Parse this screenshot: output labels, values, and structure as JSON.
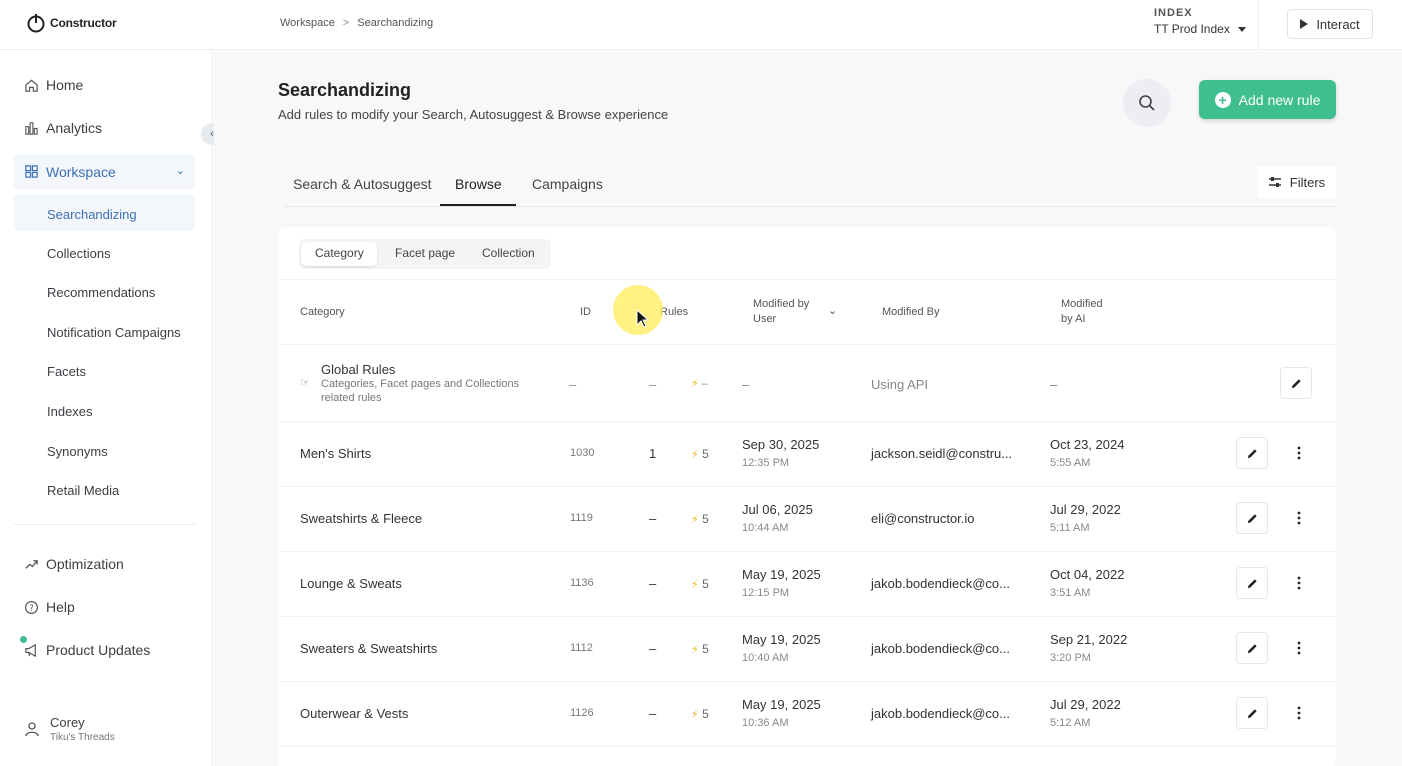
{
  "brand": {
    "name": "Constructor"
  },
  "breadcrumb": {
    "items": [
      "Workspace",
      "Searchandizing"
    ]
  },
  "index": {
    "label": "INDEX",
    "value": "TT Prod Index"
  },
  "topbar": {
    "interact_label": "Interact"
  },
  "sidebar": {
    "home": "Home",
    "analytics": "Analytics",
    "workspace": "Workspace",
    "workspace_items": [
      "Searchandizing",
      "Collections",
      "Recommendations",
      "Notification Campaigns",
      "Facets",
      "Indexes",
      "Synonyms",
      "Retail Media"
    ],
    "optimization": "Optimization",
    "help": "Help",
    "product_updates": "Product Updates",
    "user": {
      "name": "Corey",
      "org": "Tiku's Threads"
    }
  },
  "page": {
    "title": "Searchandizing",
    "subtitle": "Add rules to modify your Search, Autosuggest & Browse experience",
    "add_rule_label": "Add new rule",
    "filters_label": "Filters",
    "tabs": [
      "Search & Autosuggest",
      "Browse",
      "Campaigns"
    ],
    "active_tab": "Browse"
  },
  "segment": {
    "items": [
      "Category",
      "Facet page",
      "Collection"
    ],
    "active": "Category"
  },
  "table": {
    "headers": {
      "category": "Category",
      "id": "ID",
      "rules": "Rules",
      "modified_by_user_1": "Modified by",
      "modified_by_user_2": "User",
      "modified_by": "Modified By",
      "modified_by_ai_1": "Modified",
      "modified_by_ai_2": "by AI"
    },
    "global": {
      "title": "Global Rules",
      "desc_1": "Categories, Facet pages and Collections",
      "desc_2": "related rules",
      "id": "–",
      "count": "–",
      "rules": "–",
      "user_date": "–",
      "by": "Using API",
      "ai_date": "–"
    },
    "rows": [
      {
        "category": "Men's Shirts",
        "id": "1030",
        "count": "1",
        "rules": "5",
        "user_date": "Sep 30, 2025",
        "user_time": "12:35 PM",
        "by": "jackson.seidl@constru...",
        "ai_date": "Oct 23, 2024",
        "ai_time": "5:55 AM"
      },
      {
        "category": "Sweatshirts & Fleece",
        "id": "1119",
        "count": "–",
        "rules": "5",
        "user_date": "Jul 06, 2025",
        "user_time": "10:44 AM",
        "by": "eli@constructor.io",
        "ai_date": "Jul 29, 2022",
        "ai_time": "5:11 AM"
      },
      {
        "category": "Lounge & Sweats",
        "id": "1136",
        "count": "–",
        "rules": "5",
        "user_date": "May 19, 2025",
        "user_time": "12:15 PM",
        "by": "jakob.bodendieck@co...",
        "ai_date": "Oct 04, 2022",
        "ai_time": "3:51 AM"
      },
      {
        "category": "Sweaters & Sweatshirts",
        "id": "1112",
        "count": "–",
        "rules": "5",
        "user_date": "May 19, 2025",
        "user_time": "10:40 AM",
        "by": "jakob.bodendieck@co...",
        "ai_date": "Sep 21, 2022",
        "ai_time": "3:20 PM"
      },
      {
        "category": "Outerwear & Vests",
        "id": "1126",
        "count": "–",
        "rules": "5",
        "user_date": "May 19, 2025",
        "user_time": "10:36 AM",
        "by": "jakob.bodendieck@co...",
        "ai_date": "Jul 29, 2022",
        "ai_time": "5:12 AM"
      }
    ]
  },
  "colors": {
    "accent": "#3fbf8f",
    "active_nav": "#3d6fb6",
    "bolt": "#f1b31c"
  }
}
